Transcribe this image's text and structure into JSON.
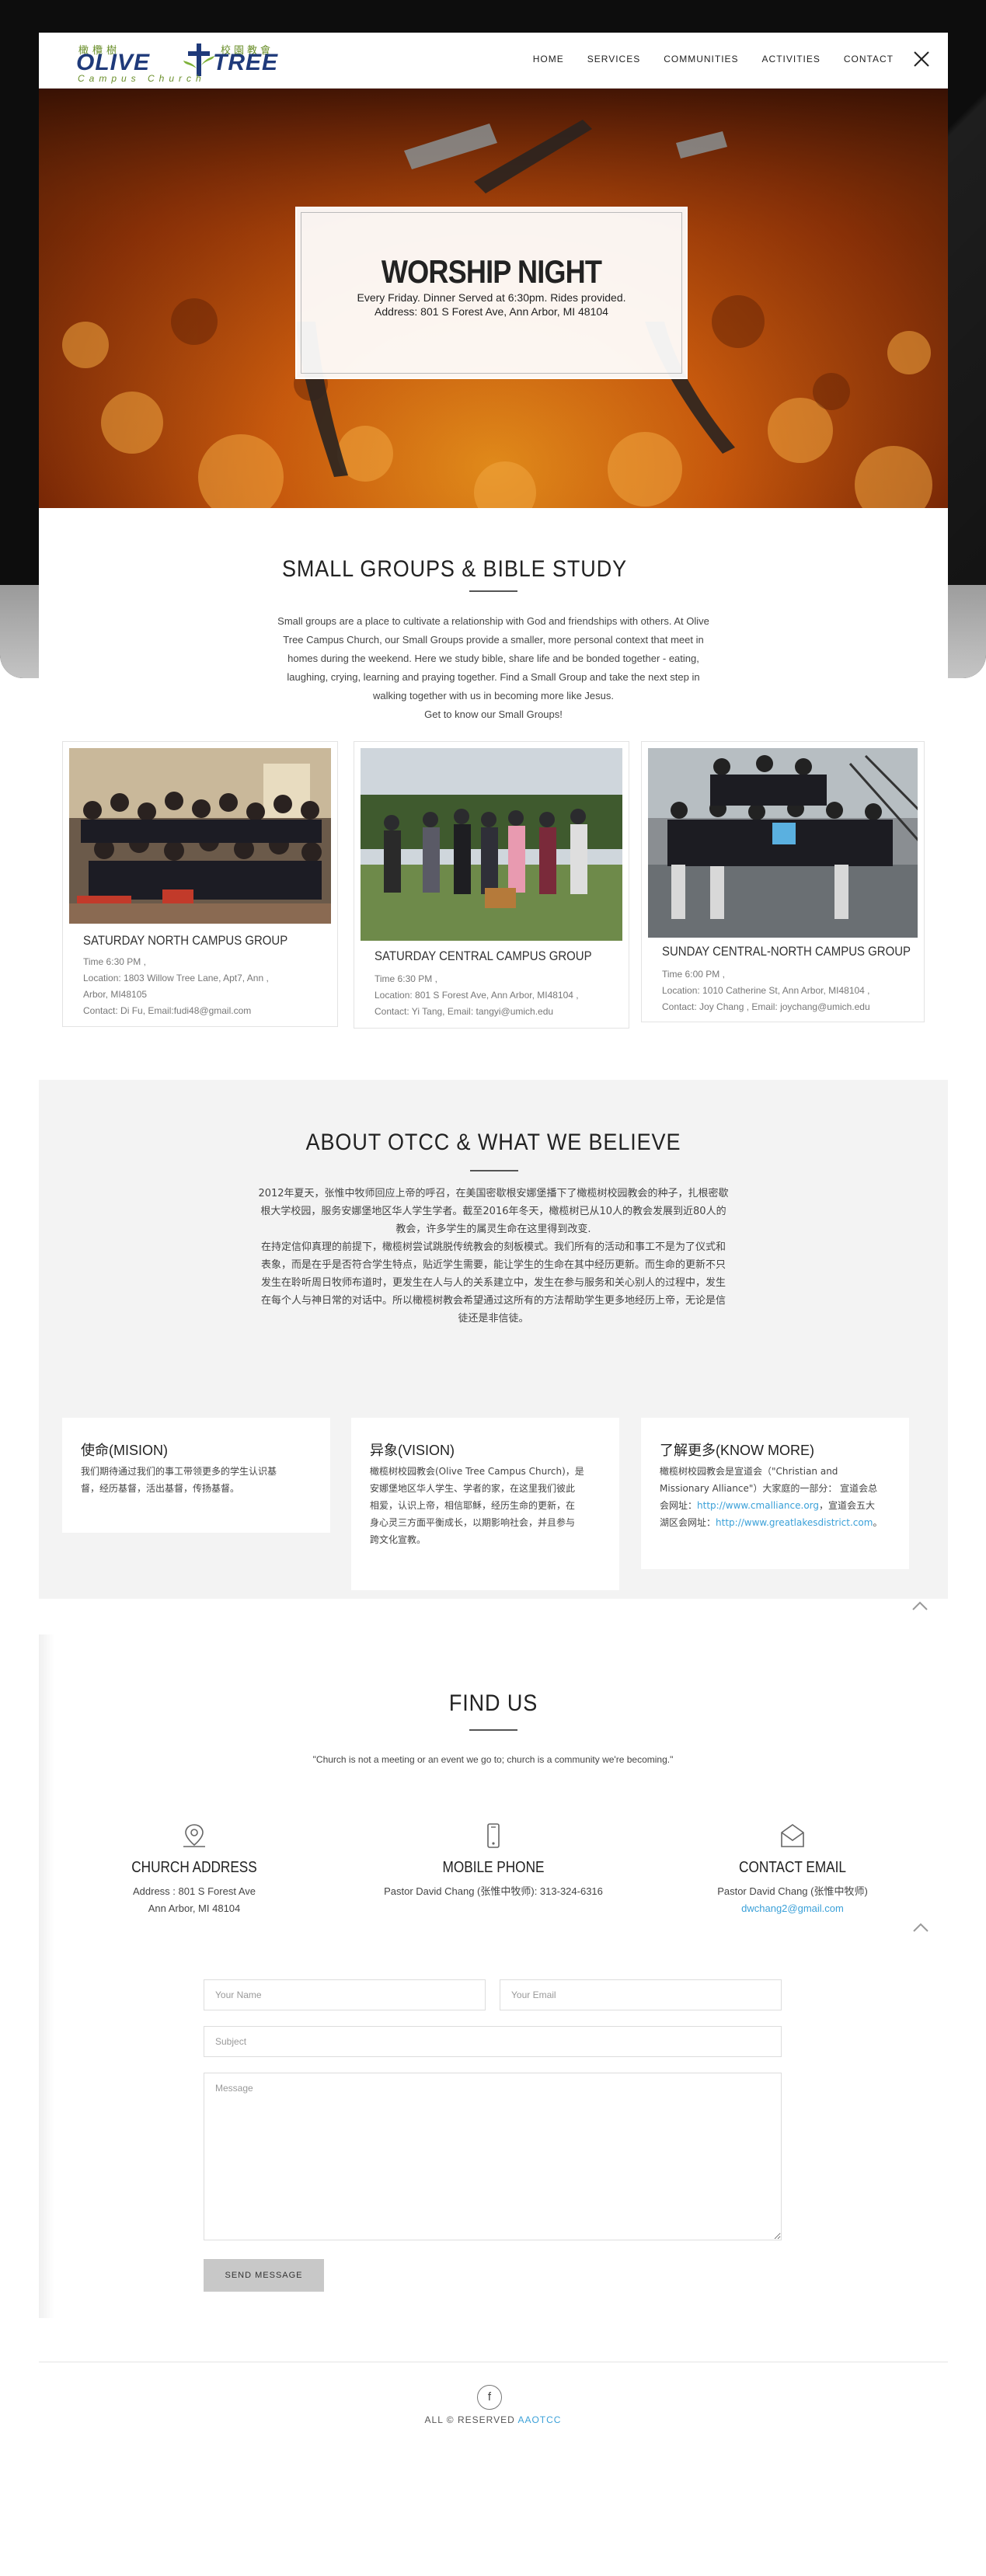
{
  "logo": {
    "chinese_left": "橄欖樹",
    "chinese_right": "校園教會",
    "word_left": "OLIVE",
    "word_right": "TREE",
    "subtitle": "Campus Church"
  },
  "nav": {
    "items": [
      "HOME",
      "SERVICES",
      "COMMUNITIES",
      "ACTIVITIES",
      "CONTACT"
    ],
    "close_icon": "close-icon"
  },
  "hero": {
    "title": "WORSHIP NIGHT",
    "line1": "Every Friday. Dinner Served at 6:30pm. Rides provided.",
    "line2": "Address: 801 S Forest Ave, Ann Arbor, MI 48104"
  },
  "small_groups": {
    "title": "SMALL GROUPS & BIBLE STUDY",
    "description": [
      "Small groups are a place to cultivate a relationship with God and friendships with others. At Olive",
      "Tree Campus Church, our Small Groups provide a smaller, more personal context that meet in",
      "homes during the weekend. Here we study bible, share life and be bonded together - eating,",
      "laughing, crying, learning and praying together. Find a Small Group and take the next step in",
      "walking together with us in becoming more like Jesus.",
      "Get to know our Small Groups!"
    ],
    "groups": [
      {
        "title": "SATURDAY NORTH CAMPUS GROUP",
        "time": "Time 6:30 PM ,",
        "location": "Location: 1803 Willow Tree Lane, Apt7, Ann        ,",
        "location2": "Arbor, MI48105",
        "contact": "Contact: Di Fu, Email:fudi48@gmail.com"
      },
      {
        "title": "SATURDAY CENTRAL CAMPUS GROUP",
        "time": "Time 6:30 PM ,",
        "location": "Location: 801 S Forest Ave, Ann Arbor, MI48104 ,",
        "contact": "Contact: Yi Tang, Email: tangyi@umich.edu"
      },
      {
        "title": "SUNDAY CENTRAL-NORTH CAMPUS GROUP",
        "time": "Time 6:00 PM ,",
        "location": "Location: 1010 Catherine St, Ann Arbor, MI48104 ,",
        "contact": "Contact: Joy Chang , Email: joychang@umich.edu"
      }
    ]
  },
  "about": {
    "title": "ABOUT OTCC & WHAT WE BELIEVE",
    "paragraph1": [
      "2012年夏天，张惟中牧师回应上帝的呼召，在美国密歇根安娜堡播下了橄榄树校园教会的种子，扎根密歇",
      "根大学校园，服务安娜堡地区华人学生学者。截至2016年冬天，橄榄树已从10人的教会发展到近80人的",
      "教会，许多学生的属灵生命在这里得到改变."
    ],
    "paragraph2": [
      "在持定信仰真理的前提下，橄榄树尝试跳脱传统教会的刻板模式。我们所有的活动和事工不是为了仪式和",
      "表象，而是在乎是否符合学生特点，贴近学生需要，能让学生的生命在其中经历更新。而生命的更新不只",
      "发生在聆听周日牧师布道时，更发生在人与人的关系建立中，发生在参与服务和关心别人的过程中，发生",
      "在每个人与神日常的对话中。所以橄榄树教会希望通过这所有的方法帮助学生更多地经历上帝，无论是信",
      "徒还是非信徒。"
    ],
    "mission": {
      "title": "使命(MISION)",
      "lines": [
        "我们期待通过我们的事工带领更多的学生认识基",
        "督，经历基督，活出基督，传扬基督。"
      ]
    },
    "vision": {
      "title": "异象(VISION)",
      "lines": [
        "橄榄树校园教会(Olive Tree Campus Church)，是",
        "安娜堡地区华人学生、学者的家，在这里我们彼此",
        "相爱，认识上帝，相信耶稣，经历生命的更新，在",
        "身心灵三方面平衡成长，以期影响社会，并且参与",
        "跨文化宣教。"
      ]
    },
    "know_more": {
      "title": "了解更多(KNOW MORE)",
      "line1": "橄榄树校园教会是宣道会（\"Christian and",
      "line2": "Missionary Alliance\"）大家庭的一部分： 宣道会总",
      "line3_prefix": "会网址：",
      "link1": "http://www.cmalliance.org",
      "line3_suffix": "，宣道会五大",
      "line4_prefix": "湖区会网址：",
      "link2": "http://www.greatlakesdistrict.com",
      "line4_suffix": "。"
    }
  },
  "find_us": {
    "title": "FIND US",
    "quote": "\"Church is not a meeting or an event we go to; church is a community we're becoming.\"",
    "address": {
      "title": "CHURCH ADDRESS",
      "line1": "Address : 801 S Forest Ave",
      "line2": "Ann Arbor, MI 48104"
    },
    "phone": {
      "title": "MOBILE PHONE",
      "line1": "Pastor David Chang (张惟中牧师): 313-324-6316"
    },
    "email": {
      "title": "CONTACT EMAIL",
      "line1": "Pastor David Chang (张惟中牧师)",
      "email": "dwchang2@gmail.com"
    }
  },
  "form": {
    "name_placeholder": "Your Name",
    "email_placeholder": "Your Email",
    "subject_placeholder": "Subject",
    "message_placeholder": "Message",
    "send_label": "SEND MESSAGE"
  },
  "footer": {
    "facebook_glyph": "f",
    "rights": "ALL © RESERVED",
    "brand_link": "AAOTCC"
  },
  "colors": {
    "accent_link": "#3aa0d8",
    "logo_blue": "#1f3a7a",
    "logo_green": "#6a8f2a",
    "hero_orange": "#c5560c"
  }
}
